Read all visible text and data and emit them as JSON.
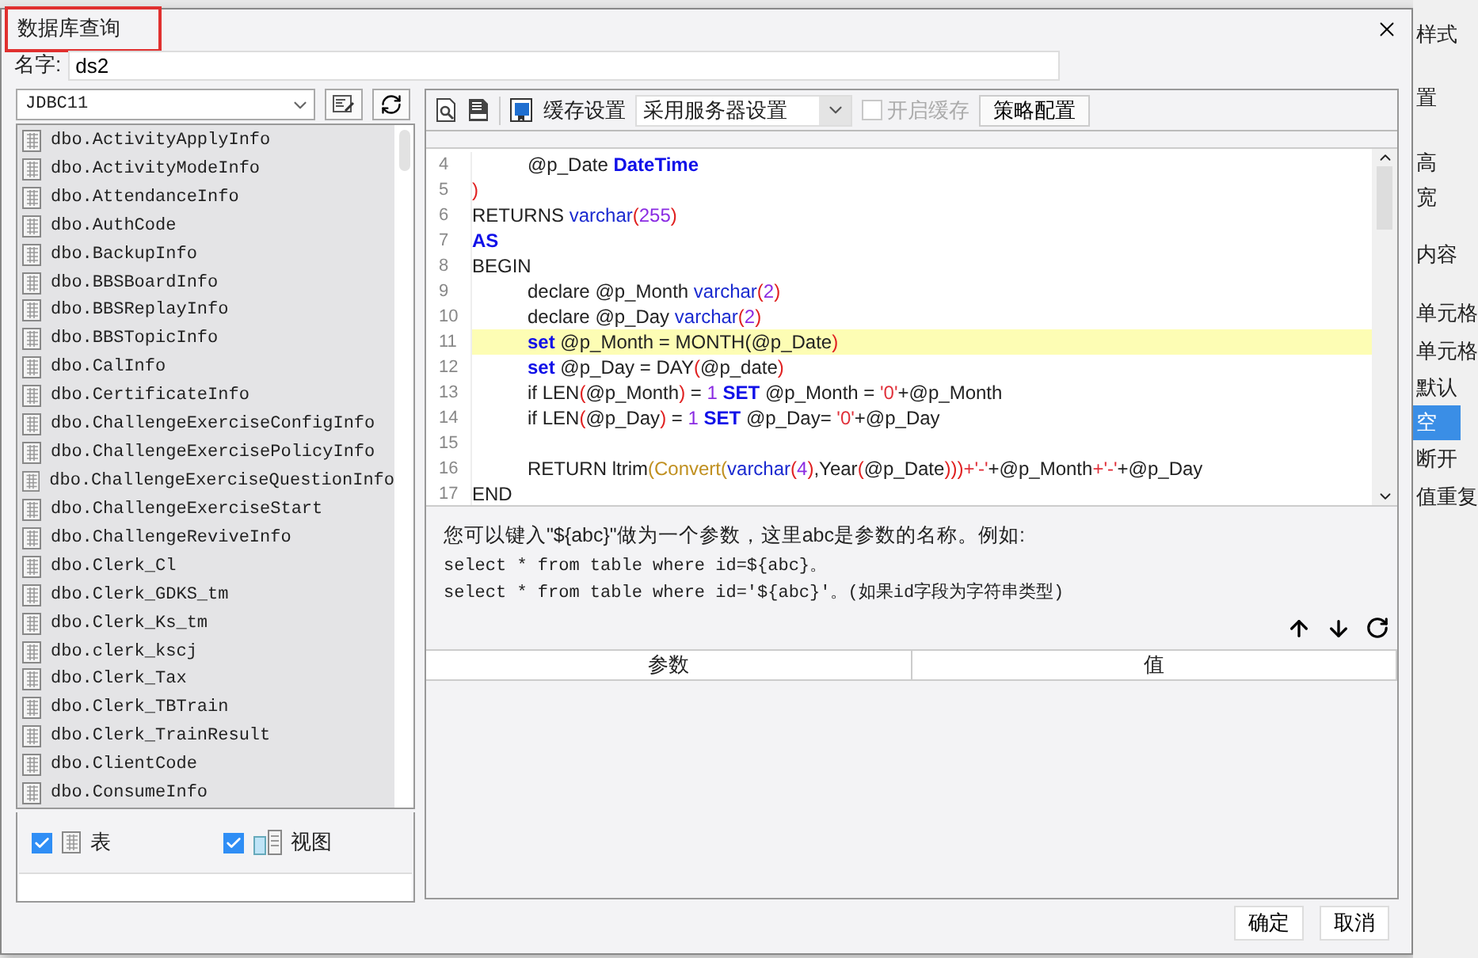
{
  "window": {
    "title": "数据库查询",
    "title_marked": true
  },
  "name_field": {
    "label": "名字:",
    "value": "ds2"
  },
  "connection": {
    "value": "JDBC11"
  },
  "tables": [
    {
      "label": "dbo.ActivityApplyInfo"
    },
    {
      "label": "dbo.ActivityModeInfo"
    },
    {
      "label": "dbo.AttendanceInfo"
    },
    {
      "label": "dbo.AuthCode"
    },
    {
      "label": "dbo.BackupInfo"
    },
    {
      "label": "dbo.BBSBoardInfo"
    },
    {
      "label": "dbo.BBSReplayInfo"
    },
    {
      "label": "dbo.BBSTopicInfo"
    },
    {
      "label": "dbo.CalInfo"
    },
    {
      "label": "dbo.CertificateInfo"
    },
    {
      "label": "dbo.ChallengeExerciseConfigInfo"
    },
    {
      "label": "dbo.ChallengeExercisePolicyInfo"
    },
    {
      "label": "dbo.ChallengeExerciseQuestionInfo"
    },
    {
      "label": "dbo.ChallengeExerciseStart"
    },
    {
      "label": "dbo.ChallengeReviveInfo"
    },
    {
      "label": "dbo.Clerk_Cl"
    },
    {
      "label": "dbo.Clerk_GDKS_tm"
    },
    {
      "label": "dbo.Clerk_Ks_tm"
    },
    {
      "label": "dbo.clerk_kscj"
    },
    {
      "label": "dbo.Clerk_Tax"
    },
    {
      "label": "dbo.Clerk_TBTrain"
    },
    {
      "label": "dbo.Clerk_TrainResult"
    },
    {
      "label": "dbo.ClientCode"
    },
    {
      "label": "dbo.ConsumeInfo"
    }
  ],
  "filters": [
    {
      "label": "表",
      "kind": "table",
      "checked": true
    },
    {
      "label": "视图",
      "kind": "view",
      "checked": true
    }
  ],
  "toolbar": {
    "cache_label": "缓存设置",
    "cache_mode": "采用服务器设置",
    "enable_cache": {
      "label": "开启缓存",
      "checked": false,
      "disabled": true
    },
    "policy_button": "策略配置"
  },
  "editor": {
    "lines": [
      {
        "number": "4",
        "highlighted": false,
        "indented": true,
        "tokens": [
          {
            "kind": "plain",
            "text": "@p_Date "
          },
          {
            "kind": "kw",
            "text": "DateTime"
          }
        ]
      },
      {
        "number": "5",
        "highlighted": false,
        "indented": false,
        "tokens": [
          {
            "kind": "paren",
            "text": ")"
          }
        ]
      },
      {
        "number": "6",
        "highlighted": false,
        "indented": false,
        "tokens": [
          {
            "kind": "plain",
            "text": "RETURNS "
          },
          {
            "kind": "type",
            "text": "varchar"
          },
          {
            "kind": "paren",
            "text": "("
          },
          {
            "kind": "num",
            "text": "255"
          },
          {
            "kind": "paren",
            "text": ")"
          }
        ]
      },
      {
        "number": "7",
        "highlighted": false,
        "indented": false,
        "tokens": [
          {
            "kind": "kw",
            "text": "AS"
          }
        ]
      },
      {
        "number": "8",
        "highlighted": false,
        "indented": false,
        "tokens": [
          {
            "kind": "plain",
            "text": "BEGIN"
          }
        ]
      },
      {
        "number": "9",
        "highlighted": false,
        "indented": true,
        "tokens": [
          {
            "kind": "plain",
            "text": "declare @p_Month "
          },
          {
            "kind": "type",
            "text": "varchar"
          },
          {
            "kind": "paren",
            "text": "("
          },
          {
            "kind": "num",
            "text": "2"
          },
          {
            "kind": "paren",
            "text": ")"
          }
        ]
      },
      {
        "number": "10",
        "highlighted": false,
        "indented": true,
        "tokens": [
          {
            "kind": "plain",
            "text": "declare @p_Day "
          },
          {
            "kind": "type",
            "text": "varchar"
          },
          {
            "kind": "paren",
            "text": "("
          },
          {
            "kind": "num",
            "text": "2"
          },
          {
            "kind": "paren",
            "text": ")"
          }
        ]
      },
      {
        "number": "11",
        "highlighted": true,
        "indented": true,
        "tokens": [
          {
            "kind": "kw",
            "text": "set"
          },
          {
            "kind": "plain",
            "text": " @p_Month = MONTH(@p_Date"
          },
          {
            "kind": "paren",
            "text": ")"
          }
        ]
      },
      {
        "number": "12",
        "highlighted": false,
        "indented": true,
        "tokens": [
          {
            "kind": "kw",
            "text": "set"
          },
          {
            "kind": "plain",
            "text": " @p_Day = DAY"
          },
          {
            "kind": "paren",
            "text": "("
          },
          {
            "kind": "plain",
            "text": "@p_date"
          },
          {
            "kind": "paren",
            "text": ")"
          }
        ]
      },
      {
        "number": "13",
        "highlighted": false,
        "indented": true,
        "tokens": [
          {
            "kind": "plain",
            "text": "if LEN"
          },
          {
            "kind": "paren",
            "text": "("
          },
          {
            "kind": "plain",
            "text": "@p_Month"
          },
          {
            "kind": "paren",
            "text": ")"
          },
          {
            "kind": "plain",
            "text": " = "
          },
          {
            "kind": "num",
            "text": "1"
          },
          {
            "kind": "kw",
            "text": " SET"
          },
          {
            "kind": "plain",
            "text": " @p_Month = "
          },
          {
            "kind": "str",
            "text": "'0'"
          },
          {
            "kind": "plain",
            "text": "+@p_Month"
          }
        ]
      },
      {
        "number": "14",
        "highlighted": false,
        "indented": true,
        "tokens": [
          {
            "kind": "plain",
            "text": "if LEN"
          },
          {
            "kind": "paren",
            "text": "("
          },
          {
            "kind": "plain",
            "text": "@p_Day"
          },
          {
            "kind": "paren",
            "text": ")"
          },
          {
            "kind": "plain",
            "text": " = "
          },
          {
            "kind": "num",
            "text": "1"
          },
          {
            "kind": "kw",
            "text": " SET"
          },
          {
            "kind": "plain",
            "text": " @p_Day= "
          },
          {
            "kind": "str",
            "text": "'0'"
          },
          {
            "kind": "plain",
            "text": "+@p_Day"
          }
        ]
      },
      {
        "number": "15",
        "highlighted": false
      },
      {
        "number": "16",
        "highlighted": false,
        "indented": true,
        "tokens": [
          {
            "kind": "plain",
            "text": "RETURN ltrim"
          },
          {
            "kind": "fn",
            "text": "(Convert("
          },
          {
            "kind": "type",
            "text": "varchar"
          },
          {
            "kind": "paren",
            "text": "("
          },
          {
            "kind": "num",
            "text": "4"
          },
          {
            "kind": "paren",
            "text": ")"
          },
          {
            "kind": "plain",
            "text": ",Year"
          },
          {
            "kind": "paren",
            "text": "("
          },
          {
            "kind": "plain",
            "text": "@p_Date"
          },
          {
            "kind": "paren",
            "text": ")))"
          },
          {
            "kind": "str",
            "text": "+'-'"
          },
          {
            "kind": "plain",
            "text": "+@p_Month"
          },
          {
            "kind": "str",
            "text": "+'-'"
          },
          {
            "kind": "plain",
            "text": "+@p_Day"
          }
        ]
      },
      {
        "number": "17",
        "highlighted": false,
        "indented": false,
        "tokens": [
          {
            "kind": "plain",
            "text": "END"
          }
        ]
      }
    ]
  },
  "hint": [
    "您可以键入\"${abc}\"做为一个参数，这里abc是参数的名称。例如:",
    "select * from table where id=${abc}。",
    "select * from table where id='${abc}'。(如果id字段为字符串类型)"
  ],
  "params_table": {
    "columns": [
      "参数",
      "值"
    ]
  },
  "buttons": [
    "确定",
    "取消"
  ],
  "background_labels": [
    "样式",
    "置",
    "高",
    "宽",
    "内容",
    "单元格",
    "单元格",
    "默认",
    "空",
    "断开",
    "值重复"
  ]
}
